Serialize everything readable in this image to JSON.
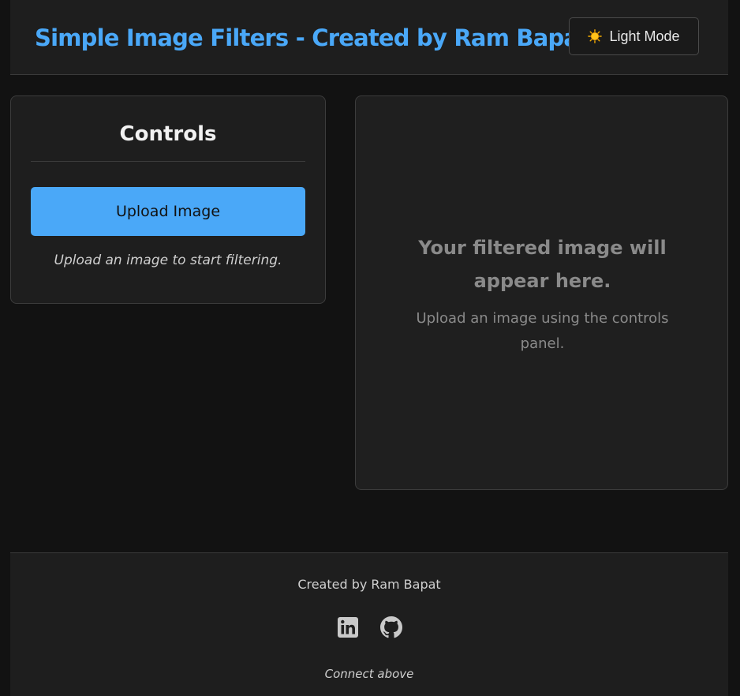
{
  "header": {
    "title": "Simple Image Filters - Created by Ram Bapat",
    "theme_toggle_label": "Light Mode",
    "theme_toggle_icon": "sun-icon"
  },
  "controls": {
    "title": "Controls",
    "upload_button_label": "Upload Image",
    "hint": "Upload an image to start filtering."
  },
  "preview": {
    "heading": "Your filtered image will appear here.",
    "subtext": "Upload an image using the controls panel."
  },
  "footer": {
    "credit": "Created by Ram Bapat",
    "social_links": [
      {
        "icon": "linkedin-icon"
      },
      {
        "icon": "github-icon"
      }
    ],
    "note": "Connect above"
  },
  "colors": {
    "accent": "#4aa8f8",
    "background": "#121212",
    "surface": "#1e1e1e",
    "muted_text": "#8a8a8a"
  }
}
